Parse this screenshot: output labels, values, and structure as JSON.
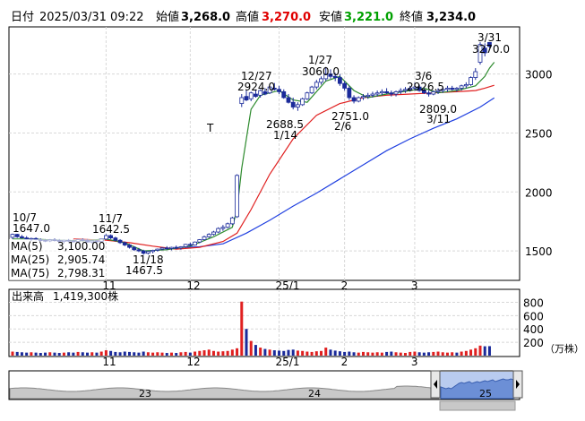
{
  "header": {
    "date_label": "日付",
    "date_value": "2025/03/31 09:22",
    "open_label": "始値",
    "open_value": "3,268.0",
    "high_label": "高値",
    "high_value": "3,270.0",
    "low_label": "安値",
    "low_value": "3,221.0",
    "close_label": "終値",
    "close_value": "3,234.0"
  },
  "ma_legend": [
    {
      "label": "MA(5)",
      "value": "3,100.00",
      "color": "#2e8b2e"
    },
    {
      "label": "MA(25)",
      "value": "2,905.74",
      "color": "#e02020"
    },
    {
      "label": "MA(75)",
      "value": "2,798.31",
      "color": "#2040e0"
    }
  ],
  "volume_legend": {
    "label": "出来高",
    "value": "1,419,300株"
  },
  "volume_unit": "（万株）",
  "overview_labels": [
    "23",
    "24",
    "25"
  ],
  "colors": {
    "up": "#ffffff",
    "down": "#1a2a9a",
    "vol_up": "#e02020",
    "vol_down": "#1a2a9a",
    "ma5": "#2e8b2e",
    "ma25": "#e02020",
    "ma75": "#2040e0",
    "header_red": "#e00000",
    "header_green": "#00a000"
  },
  "chart_data": [
    {
      "type": "candlestick",
      "title": "",
      "ylim": [
        1250,
        3400
      ],
      "yticks": [
        1500,
        2000,
        2500,
        3000
      ],
      "x_ticks": [
        "11",
        "12",
        "25/1",
        "2",
        "3"
      ],
      "annotations": [
        {
          "date": "10/7",
          "price": "1647.0"
        },
        {
          "date": "11/7",
          "price": "1642.5"
        },
        {
          "date": "11/18",
          "price": "1467.5"
        },
        {
          "date": "12/27",
          "price": "2924.0"
        },
        {
          "date": "1/14",
          "price": "2688.5"
        },
        {
          "date": "1/27",
          "price": "3060.0"
        },
        {
          "date": "2/6",
          "price": "2751.0"
        },
        {
          "date": "3/6",
          "price": "2926.5"
        },
        {
          "date": "3/11",
          "price": "2809.0"
        },
        {
          "date": "3/31",
          "price": "3270.0"
        }
      ],
      "marker": "T",
      "ohlc": [
        [
          1615,
          1647,
          1600,
          1640
        ],
        [
          1640,
          1645,
          1610,
          1620
        ],
        [
          1620,
          1635,
          1605,
          1610
        ],
        [
          1610,
          1625,
          1595,
          1600
        ],
        [
          1600,
          1612,
          1585,
          1605
        ],
        [
          1605,
          1615,
          1590,
          1595
        ],
        [
          1595,
          1605,
          1580,
          1590
        ],
        [
          1590,
          1600,
          1575,
          1585
        ],
        [
          1585,
          1600,
          1575,
          1595
        ],
        [
          1595,
          1605,
          1580,
          1590
        ],
        [
          1590,
          1600,
          1570,
          1580
        ],
        [
          1580,
          1595,
          1565,
          1590
        ],
        [
          1590,
          1600,
          1575,
          1585
        ],
        [
          1585,
          1595,
          1570,
          1580
        ],
        [
          1580,
          1600,
          1570,
          1595
        ],
        [
          1595,
          1605,
          1580,
          1590
        ],
        [
          1590,
          1600,
          1570,
          1575
        ],
        [
          1575,
          1590,
          1565,
          1585
        ],
        [
          1585,
          1595,
          1570,
          1580
        ],
        [
          1580,
          1600,
          1570,
          1600
        ],
        [
          1600,
          1642,
          1595,
          1630
        ],
        [
          1630,
          1640,
          1600,
          1610
        ],
        [
          1610,
          1620,
          1580,
          1590
        ],
        [
          1590,
          1600,
          1560,
          1570
        ],
        [
          1570,
          1580,
          1540,
          1550
        ],
        [
          1550,
          1560,
          1520,
          1530
        ],
        [
          1530,
          1540,
          1500,
          1510
        ],
        [
          1510,
          1525,
          1490,
          1500
        ],
        [
          1500,
          1510,
          1467,
          1480
        ],
        [
          1480,
          1500,
          1470,
          1495
        ],
        [
          1495,
          1510,
          1480,
          1505
        ],
        [
          1505,
          1520,
          1495,
          1515
        ],
        [
          1515,
          1530,
          1505,
          1525
        ],
        [
          1525,
          1540,
          1510,
          1520
        ],
        [
          1520,
          1535,
          1505,
          1530
        ],
        [
          1530,
          1545,
          1515,
          1525
        ],
        [
          1525,
          1540,
          1510,
          1535
        ],
        [
          1535,
          1560,
          1525,
          1555
        ],
        [
          1555,
          1570,
          1540,
          1550
        ],
        [
          1550,
          1580,
          1545,
          1575
        ],
        [
          1575,
          1600,
          1565,
          1595
        ],
        [
          1595,
          1630,
          1590,
          1620
        ],
        [
          1620,
          1650,
          1610,
          1640
        ],
        [
          1640,
          1670,
          1630,
          1660
        ],
        [
          1660,
          1700,
          1650,
          1690
        ],
        [
          1690,
          1720,
          1670,
          1700
        ],
        [
          1700,
          1740,
          1690,
          1730
        ],
        [
          1730,
          1790,
          1720,
          1780
        ],
        [
          1790,
          2150,
          1780,
          2140
        ],
        [
          2750,
          2830,
          2720,
          2800
        ],
        [
          2810,
          2860,
          2770,
          2780
        ],
        [
          2790,
          2850,
          2770,
          2840
        ],
        [
          2830,
          2870,
          2800,
          2810
        ],
        [
          2820,
          2870,
          2800,
          2860
        ],
        [
          2850,
          2880,
          2820,
          2830
        ],
        [
          2840,
          2900,
          2830,
          2890
        ],
        [
          2880,
          2924,
          2860,
          2870
        ],
        [
          2870,
          2900,
          2830,
          2850
        ],
        [
          2850,
          2870,
          2790,
          2800
        ],
        [
          2800,
          2830,
          2750,
          2760
        ],
        [
          2760,
          2800,
          2700,
          2720
        ],
        [
          2720,
          2760,
          2688,
          2740
        ],
        [
          2740,
          2800,
          2730,
          2790
        ],
        [
          2790,
          2850,
          2780,
          2840
        ],
        [
          2840,
          2900,
          2830,
          2890
        ],
        [
          2890,
          2950,
          2870,
          2930
        ],
        [
          2930,
          2980,
          2910,
          2960
        ],
        [
          2960,
          3060,
          2940,
          3000
        ],
        [
          3000,
          3040,
          2960,
          2980
        ],
        [
          2980,
          3010,
          2940,
          2970
        ],
        [
          2970,
          3000,
          2900,
          2920
        ],
        [
          2920,
          2940,
          2860,
          2880
        ],
        [
          2880,
          2900,
          2780,
          2800
        ],
        [
          2800,
          2820,
          2751,
          2770
        ],
        [
          2770,
          2810,
          2760,
          2800
        ],
        [
          2800,
          2830,
          2780,
          2810
        ],
        [
          2810,
          2840,
          2790,
          2820
        ],
        [
          2820,
          2850,
          2800,
          2830
        ],
        [
          2830,
          2860,
          2810,
          2840
        ],
        [
          2840,
          2870,
          2820,
          2850
        ],
        [
          2850,
          2880,
          2830,
          2840
        ],
        [
          2840,
          2860,
          2810,
          2830
        ],
        [
          2830,
          2860,
          2810,
          2850
        ],
        [
          2850,
          2880,
          2830,
          2860
        ],
        [
          2860,
          2890,
          2840,
          2870
        ],
        [
          2870,
          2900,
          2850,
          2880
        ],
        [
          2880,
          2926,
          2860,
          2890
        ],
        [
          2890,
          2910,
          2850,
          2860
        ],
        [
          2860,
          2880,
          2830,
          2840
        ],
        [
          2840,
          2860,
          2809,
          2830
        ],
        [
          2830,
          2860,
          2820,
          2850
        ],
        [
          2850,
          2880,
          2830,
          2860
        ],
        [
          2860,
          2890,
          2840,
          2870
        ],
        [
          2870,
          2900,
          2850,
          2880
        ],
        [
          2880,
          2900,
          2860,
          2870
        ],
        [
          2870,
          2890,
          2850,
          2880
        ],
        [
          2880,
          2910,
          2860,
          2900
        ],
        [
          2900,
          2930,
          2880,
          2910
        ],
        [
          2910,
          2980,
          2900,
          2970
        ],
        [
          2970,
          3050,
          2950,
          3020
        ],
        [
          3100,
          3270,
          3080,
          3250
        ],
        [
          3220,
          3260,
          3150,
          3180
        ],
        [
          3268,
          3270,
          3221,
          3234
        ]
      ],
      "ma5": [
        [
          0,
          1600
        ],
        [
          4,
          1600
        ],
        [
          10,
          1590
        ],
        [
          15,
          1585
        ],
        [
          20,
          1600
        ],
        [
          24,
          1570
        ],
        [
          28,
          1500
        ],
        [
          33,
          1510
        ],
        [
          38,
          1540
        ],
        [
          43,
          1620
        ],
        [
          47,
          1700
        ],
        [
          48,
          1850
        ],
        [
          49,
          2200
        ],
        [
          50,
          2450
        ],
        [
          51,
          2700
        ],
        [
          53,
          2820
        ],
        [
          57,
          2860
        ],
        [
          60,
          2780
        ],
        [
          63,
          2760
        ],
        [
          67,
          2940
        ],
        [
          70,
          2980
        ],
        [
          73,
          2860
        ],
        [
          76,
          2800
        ],
        [
          80,
          2830
        ],
        [
          85,
          2860
        ],
        [
          88,
          2880
        ],
        [
          91,
          2840
        ],
        [
          95,
          2860
        ],
        [
          99,
          2900
        ],
        [
          101,
          2980
        ],
        [
          102,
          3050
        ],
        [
          103,
          3100
        ]
      ],
      "ma25": [
        [
          13,
          1600
        ],
        [
          20,
          1590
        ],
        [
          25,
          1570
        ],
        [
          30,
          1540
        ],
        [
          35,
          1515
        ],
        [
          40,
          1530
        ],
        [
          45,
          1580
        ],
        [
          48,
          1650
        ],
        [
          51,
          1850
        ],
        [
          55,
          2150
        ],
        [
          60,
          2450
        ],
        [
          65,
          2650
        ],
        [
          70,
          2750
        ],
        [
          75,
          2800
        ],
        [
          80,
          2820
        ],
        [
          85,
          2830
        ],
        [
          90,
          2840
        ],
        [
          95,
          2850
        ],
        [
          99,
          2860
        ],
        [
          101,
          2880
        ],
        [
          103,
          2905
        ]
      ],
      "ma75": [
        [
          36,
          1530
        ],
        [
          40,
          1535
        ],
        [
          45,
          1560
        ],
        [
          50,
          1650
        ],
        [
          55,
          1760
        ],
        [
          60,
          1880
        ],
        [
          65,
          1990
        ],
        [
          70,
          2110
        ],
        [
          75,
          2230
        ],
        [
          80,
          2350
        ],
        [
          85,
          2450
        ],
        [
          90,
          2540
        ],
        [
          95,
          2620
        ],
        [
          100,
          2720
        ],
        [
          103,
          2798
        ]
      ]
    },
    {
      "type": "bar",
      "title": "",
      "ylim": [
        0,
        900
      ],
      "yticks": [
        200,
        400,
        600,
        800
      ],
      "x_ticks": [
        "11",
        "12",
        "25/1",
        "2",
        "3"
      ],
      "values": [
        60,
        55,
        50,
        45,
        50,
        45,
        40,
        45,
        50,
        45,
        40,
        45,
        50,
        45,
        55,
        50,
        45,
        50,
        45,
        60,
        80,
        70,
        55,
        50,
        60,
        55,
        50,
        45,
        60,
        50,
        45,
        50,
        45,
        40,
        45,
        40,
        50,
        55,
        45,
        60,
        70,
        80,
        90,
        70,
        60,
        65,
        70,
        90,
        110,
        810,
        400,
        220,
        160,
        120,
        100,
        90,
        80,
        75,
        70,
        85,
        90,
        75,
        70,
        60,
        55,
        65,
        70,
        120,
        90,
        75,
        65,
        55,
        60,
        50,
        45,
        55,
        50,
        45,
        50,
        45,
        55,
        60,
        50,
        45,
        40,
        55,
        60,
        50,
        45,
        50,
        55,
        60,
        50,
        45,
        50,
        45,
        60,
        70,
        90,
        110,
        150,
        140,
        142
      ],
      "up": [
        1,
        0,
        0,
        0,
        1,
        0,
        0,
        0,
        1,
        0,
        0,
        1,
        0,
        0,
        1,
        0,
        0,
        1,
        0,
        1,
        1,
        0,
        0,
        0,
        0,
        0,
        0,
        0,
        0,
        1,
        1,
        1,
        1,
        0,
        1,
        0,
        1,
        1,
        0,
        1,
        1,
        1,
        1,
        1,
        1,
        1,
        1,
        1,
        1,
        1,
        0,
        1,
        0,
        1,
        0,
        1,
        0,
        0,
        0,
        0,
        0,
        1,
        1,
        1,
        1,
        1,
        1,
        1,
        0,
        0,
        0,
        0,
        0,
        0,
        1,
        1,
        1,
        1,
        1,
        1,
        0,
        0,
        1,
        1,
        1,
        1,
        1,
        0,
        0,
        0,
        1,
        1,
        1,
        1,
        1,
        0,
        1,
        1,
        1,
        1,
        1,
        0,
        0
      ]
    }
  ]
}
